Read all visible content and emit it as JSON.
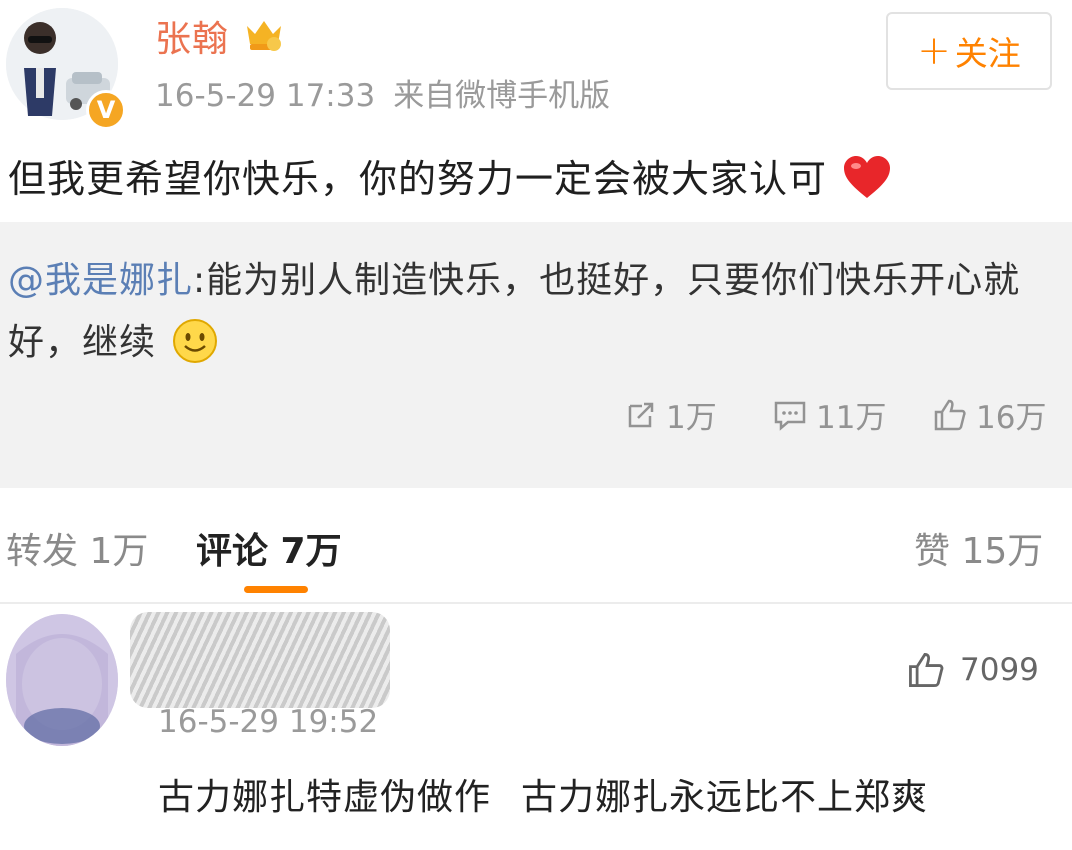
{
  "post": {
    "username": "张翰",
    "time": "16-5-29 17:33",
    "source": "来自微博手机版",
    "follow_label": "关注",
    "follow_plus": "+",
    "text": "但我更希望你快乐，你的努力一定会被大家认可",
    "verified_badge": "V"
  },
  "repost": {
    "mention": "@我是娜扎",
    "text": ":能为别人制造快乐，也挺好，只要你们快乐开心就好，继续",
    "repost_count": "1万",
    "comment_count": "11万",
    "like_count": "16万"
  },
  "tabs": {
    "repost": "转发 1万",
    "comment": "评论 7万",
    "like": "赞 15万"
  },
  "comment": {
    "time": "16-5-29 19:52",
    "likes": "7099",
    "text_part1": "古力娜扎特虚伪做作",
    "text_part2": "古力娜扎永远比不上郑爽"
  },
  "colors": {
    "accent": "#ff8200",
    "username": "#eb7350",
    "mention": "#5b7fb5",
    "muted": "#9a9a9a"
  },
  "icons": [
    "crown-icon",
    "verified-icon",
    "heart-icon",
    "smile-icon",
    "repost-icon",
    "comment-icon",
    "like-icon"
  ]
}
